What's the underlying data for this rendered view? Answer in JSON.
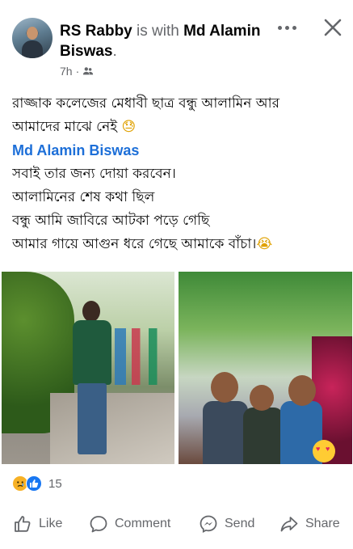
{
  "post": {
    "author": "RS Rabby",
    "with_text": "is with",
    "tagged": "Md Alamin Biswas",
    "period": ".",
    "time": "7h",
    "separator": "·",
    "audience_icon": "friends-icon"
  },
  "header_buttons": {
    "more_icon": "more-horizontal-icon",
    "close_icon": "close-icon"
  },
  "body": {
    "line1": "রাজ্জাক কলেজের মেধাবী ছাত্র বন্ধু আলামিন আর",
    "line2": "আমাদের মাঝে নেই",
    "line2_emoji": "😓",
    "mention": "Md Alamin Biswas",
    "line3": "সবাই তার জন্য দোয়া করবেন।",
    "line4": "আলামিনের শেষ কথা ছিল",
    "line5": "বন্ধু আমি জাবিরে আটকা পড়ে গেছি",
    "line6": "আমার গায়ে আগুন ধরে গেছে আমাকে বাঁচা।",
    "line6_emoji": "😭"
  },
  "photos": [
    {
      "name": "photo-standing-on-path"
    },
    {
      "name": "photo-group-selfie",
      "sticker": "heart-eyes-emoji"
    }
  ],
  "reactions": {
    "icons": [
      "sad-reaction-icon",
      "like-reaction-icon"
    ],
    "count": "15"
  },
  "actions": [
    {
      "label": "Like",
      "icon": "thumbs-up-icon"
    },
    {
      "label": "Comment",
      "icon": "comment-bubble-icon"
    },
    {
      "label": "Send",
      "icon": "messenger-icon"
    },
    {
      "label": "Share",
      "icon": "share-arrow-icon"
    }
  ],
  "colors": {
    "link_blue": "#1d6fd8",
    "secondary_text": "#65676b",
    "like_blue": "#1877f2",
    "sad_yellow": "#f7b125"
  }
}
